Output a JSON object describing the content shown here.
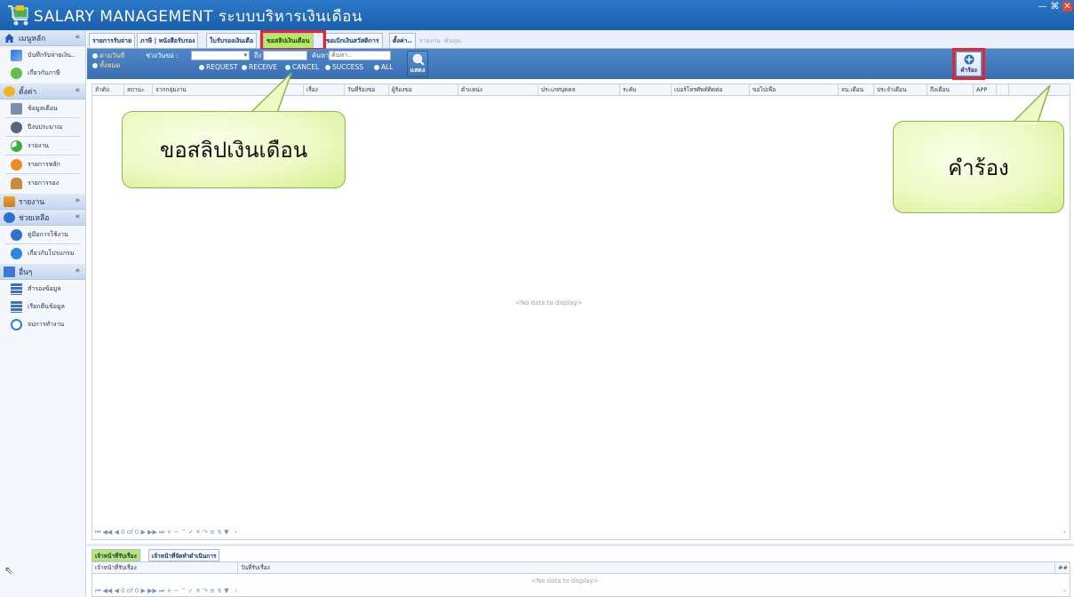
{
  "app": {
    "title": "SALARY MANAGEMENT ระบบบริหารเงินเดือน",
    "window_buttons": [
      "—",
      "⌘",
      "✕"
    ]
  },
  "sidebar": {
    "groups": [
      {
        "label": "เมนูหลัก",
        "chevron": "«",
        "items": [
          {
            "label": "บันทึกรับจ่ายเงิน..",
            "icon": "transfer-icon"
          },
          {
            "label": "เกี่ยวกับภาษี",
            "icon": "tax-icon"
          }
        ]
      },
      {
        "label": "ตั้งค่า",
        "chevron": "«",
        "items": [
          {
            "label": "ข้อมูลเดือน",
            "icon": "calendar-icon"
          },
          {
            "label": "ปีงบประมาณ",
            "icon": "year-icon"
          },
          {
            "label": "รายงาน",
            "icon": "report-icon"
          },
          {
            "label": "รายการหลัก",
            "icon": "main-list-icon"
          },
          {
            "label": "รายการรอง",
            "icon": "user-icon"
          }
        ]
      },
      {
        "label": "รายงาน",
        "chevron": "»",
        "items": []
      },
      {
        "label": "ช่วยเหลือ",
        "chevron": "«",
        "items": [
          {
            "label": "คู่มือการใช้งาน",
            "icon": "help-icon"
          },
          {
            "label": "เกี่ยวกับโปรแกรม",
            "icon": "about-icon"
          }
        ]
      },
      {
        "label": "อื่นๆ",
        "chevron": "«",
        "items": [
          {
            "label": "สำรองข้อมูล",
            "icon": "backup-icon"
          },
          {
            "label": "เรียกคืนข้อมูล",
            "icon": "restore-icon"
          },
          {
            "label": "จบการทำงาน",
            "icon": "power-icon"
          }
        ]
      }
    ]
  },
  "tabs": [
    {
      "label": "รายการรับจ่าย",
      "state": "normal"
    },
    {
      "label": "ภาษี | หนังสือรับรอง",
      "state": "normal"
    },
    {
      "label": "ใบรับรองเงินเดือ",
      "state": "normal"
    },
    {
      "label": "ขอสลิปเงินเดือน",
      "state": "active"
    },
    {
      "label": "ขอเบิกเงินสวัสดิการ",
      "state": "normal"
    },
    {
      "label": "ตั้งค่า..",
      "state": "normal"
    },
    {
      "label": "รายงาน",
      "state": "disabled"
    },
    {
      "label": "ค้นหุน",
      "state": "disabled"
    }
  ],
  "filters": {
    "by_date_label": "ตามวันที่",
    "date_range_label": "ช่วงวันขอ :",
    "to_label": "ถึง",
    "search_label": "ค้นหา",
    "search_placeholder": "ค้นหา..",
    "all_label": "ทั้งหมด",
    "status_options": [
      "REQUEST",
      "RECEIVE",
      "CANCEL",
      "SUCCESS",
      "ALL"
    ],
    "show_button": "แสดง",
    "request_button": "คำร้อง"
  },
  "grid": {
    "columns": [
      "ลำดับ",
      "สถานะ",
      "จากกลุ่มงาน",
      "เรื่อง",
      "วันที่ร้องขอ",
      "ผู้ร้องขอ",
      "ตำแหน่ง",
      "ประเภทบุคคล",
      "ระดับ",
      "เบอร์โทรศัพท์ติดต่อ",
      "ขอไปเพื่อ",
      "จน.เดือน",
      "ประจำเดือน",
      "ถึงเดือน",
      "APP"
    ],
    "empty_text": "<No data to display>",
    "navigator": "⏮ ◀◀ ◀ 0 of 0 ▶ ▶▶ ⏭ + − ⌃ ✓ ✕ ↷ ≡ ↯ ▼"
  },
  "bottom": {
    "tabs": [
      {
        "label": "เจ้าหน้าที่รับเรื่อง",
        "state": "active"
      },
      {
        "label": "เจ้าหน้าที่จัดทำดำเนินการ",
        "state": "normal"
      }
    ],
    "columns": [
      "เจ้าหน้าที่รับเรื่อง",
      "วันที่รับเรื่อง"
    ],
    "empty_text": "<No data to display>",
    "navigator": "⏮ ◀◀ ◀ 0 of 0 ▶ ▶▶ ⏭ + − ⌃ ✓ ✕ ↷ ≡ ↯ ▼",
    "corner": "##"
  },
  "callouts": {
    "salary_slip": "ขอสลิปเงินเดือน",
    "request": "คำร้อง"
  },
  "colors": {
    "titlebar": "#1b5fae",
    "filterbar": "#3a70b3",
    "active_tab": "#b6e86a",
    "highlight": "#e6262c",
    "callout": "#eef9c4"
  }
}
